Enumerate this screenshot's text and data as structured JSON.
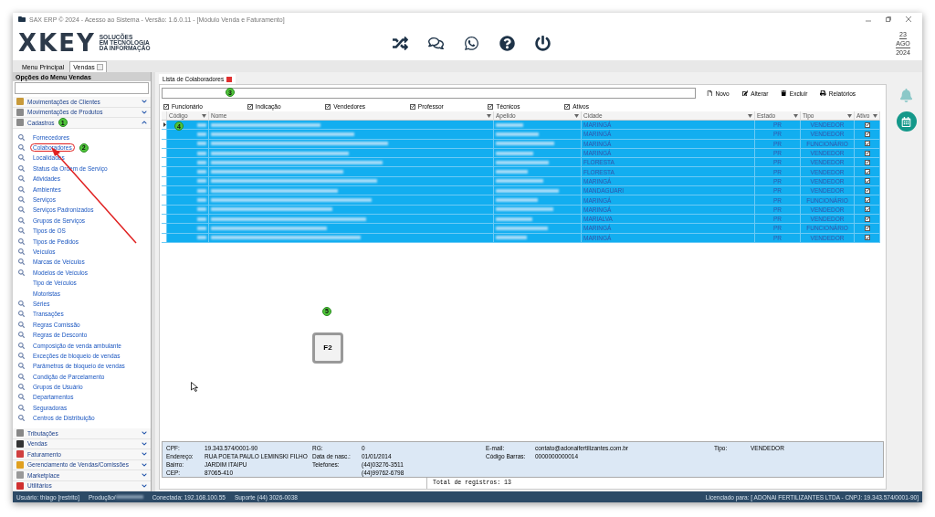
{
  "window": {
    "title": "SAX ERP © 2024 - Acesso ao Sistema - Versão: 1.6.0.11 - [Módulo Venda e Faturamento]"
  },
  "logo": {
    "mark": "XKEY",
    "tagline": [
      "SOLUÇÕES",
      "EM TECNOLOGIA",
      "DA INFORMAÇÃO"
    ]
  },
  "date": {
    "day": "23",
    "month": "AGO",
    "year": "2024"
  },
  "tabs": [
    {
      "label": "Menu Principal",
      "selected": false,
      "closable": false
    },
    {
      "label": "Vendas",
      "selected": true,
      "closable": true
    }
  ],
  "sidebar": {
    "title": "Opções do Menu Vendas",
    "groups": [
      {
        "label": "Movimentações de Clientes",
        "expanded": false
      },
      {
        "label": "Movimentações de Produtos",
        "expanded": false
      },
      {
        "label": "Cadastros",
        "expanded": true,
        "badge": "1",
        "children": [
          {
            "label": "Fornecedores",
            "kind": "search",
            "circled": false
          },
          {
            "label": "Colaboradores",
            "kind": "search",
            "circled": true,
            "badge": "2"
          },
          {
            "label": "Localidades",
            "kind": "search",
            "circled": false
          },
          {
            "label": "Status da Ordem de Serviço",
            "kind": "search",
            "circled": false
          },
          {
            "label": "Atividades",
            "kind": "search",
            "circled": false
          },
          {
            "label": "Ambientes",
            "kind": "search",
            "circled": false
          },
          {
            "label": "Serviços",
            "kind": "search",
            "circled": false
          },
          {
            "label": "Serviços Padronizados",
            "kind": "search",
            "circled": false
          },
          {
            "label": "Grupos de Serviços",
            "kind": "search",
            "circled": false
          },
          {
            "label": "Tipos de OS",
            "kind": "search",
            "circled": false
          },
          {
            "label": "Tipos de Pedidos",
            "kind": "search",
            "circled": false
          },
          {
            "label": "Veículos",
            "kind": "search",
            "circled": false
          },
          {
            "label": "Marcas de Veículos",
            "kind": "search",
            "circled": false
          },
          {
            "label": "Modelos de Veículos",
            "kind": "search",
            "circled": false
          },
          {
            "label": "Tipo de Veículos",
            "kind": "plain",
            "circled": false
          },
          {
            "label": "Motoristas",
            "kind": "plain",
            "circled": false
          },
          {
            "label": "Séries",
            "kind": "search",
            "circled": false
          },
          {
            "label": "Transações",
            "kind": "search",
            "circled": false
          },
          {
            "label": "Regras Comissão",
            "kind": "search",
            "circled": false
          },
          {
            "label": "Regras de Desconto",
            "kind": "search",
            "circled": false
          },
          {
            "label": "Composição de venda ambulante",
            "kind": "search",
            "circled": false
          },
          {
            "label": "Exceções de bloqueio de vendas",
            "kind": "search",
            "circled": false
          },
          {
            "label": "Parâmetros de bloqueio de vendas",
            "kind": "search",
            "circled": false
          },
          {
            "label": "Condição de Parcelamento",
            "kind": "search",
            "circled": false
          },
          {
            "label": "Grupos de Usuário",
            "kind": "search",
            "circled": false
          },
          {
            "label": "Departamentos",
            "kind": "search",
            "circled": false
          },
          {
            "label": "Seguradoras",
            "kind": "search",
            "circled": false
          },
          {
            "label": "Centros de Distribuição",
            "kind": "search",
            "circled": false
          }
        ]
      },
      {
        "label": "Tributações",
        "expanded": false
      },
      {
        "label": "Vendas",
        "expanded": false
      },
      {
        "label": "Faturamento",
        "expanded": false
      },
      {
        "label": "Gerenciamento de Vendas/Comissões",
        "expanded": false
      },
      {
        "label": "Marketplace",
        "expanded": false
      },
      {
        "label": "Utilitários",
        "expanded": false
      }
    ]
  },
  "document_tab": {
    "label": "Lista de Colaboradores"
  },
  "toolbar": {
    "search_badge": "3",
    "buttons": [
      "Novo",
      "Alterar",
      "Excluir",
      "Relatórios"
    ]
  },
  "filters": [
    {
      "label": "Funcionário",
      "checked": true
    },
    {
      "label": "Indicação",
      "checked": true
    },
    {
      "label": "Vendedores",
      "checked": true
    },
    {
      "label": "Professor",
      "checked": true
    },
    {
      "label": "Técnicos",
      "checked": true
    },
    {
      "label": "Ativos",
      "checked": true
    }
  ],
  "table": {
    "columns": [
      "Código",
      "Nome",
      "Apelido",
      "Cidade",
      "Estado",
      "Tipo",
      "Ativo"
    ],
    "row_badge": "4",
    "rows": [
      {
        "cidade": "MARINGÁ",
        "estado": "PR",
        "tipo": "VENDEDOR",
        "ativo": true,
        "selected": true,
        "current": true
      },
      {
        "cidade": "MARINGÁ",
        "estado": "PR",
        "tipo": "VENDEDOR",
        "ativo": true,
        "selected": true,
        "current": false
      },
      {
        "cidade": "MARINGÁ",
        "estado": "PR",
        "tipo": "FUNCIONÁRIO",
        "ativo": true,
        "selected": true,
        "current": false
      },
      {
        "cidade": "MARINGÁ",
        "estado": "PR",
        "tipo": "VENDEDOR",
        "ativo": true,
        "selected": true,
        "current": false
      },
      {
        "cidade": "FLORESTA",
        "estado": "PR",
        "tipo": "VENDEDOR",
        "ativo": true,
        "selected": true,
        "current": false
      },
      {
        "cidade": "FLORESTA",
        "estado": "PR",
        "tipo": "VENDEDOR",
        "ativo": true,
        "selected": true,
        "current": false
      },
      {
        "cidade": "MARINGÁ",
        "estado": "PR",
        "tipo": "VENDEDOR",
        "ativo": true,
        "selected": true,
        "current": false
      },
      {
        "cidade": "MANDAGUARI",
        "estado": "PR",
        "tipo": "VENDEDOR",
        "ativo": true,
        "selected": true,
        "current": false
      },
      {
        "cidade": "MARINGÁ",
        "estado": "PR",
        "tipo": "FUNCIONÁRIO",
        "ativo": true,
        "selected": true,
        "current": false
      },
      {
        "cidade": "MARINGÁ",
        "estado": "PR",
        "tipo": "VENDEDOR",
        "ativo": true,
        "selected": true,
        "current": false
      },
      {
        "cidade": "MARIALVA",
        "estado": "PR",
        "tipo": "VENDEDOR",
        "ativo": true,
        "selected": true,
        "current": false
      },
      {
        "cidade": "MARINGÁ",
        "estado": "PR",
        "tipo": "FUNCIONÁRIO",
        "ativo": true,
        "selected": true,
        "current": false
      },
      {
        "cidade": "MARINGÁ",
        "estado": "PR",
        "tipo": "VENDEDOR",
        "ativo": true,
        "selected": true,
        "current": false
      }
    ]
  },
  "hint": {
    "badge": "5",
    "key": "F2"
  },
  "details": [
    [
      {
        "label": "CPF:",
        "value": "19.343.574/0001-90"
      },
      {
        "label": "Endereço:",
        "value": "RUA POETA PAULO LEMINSKI FILHO"
      },
      {
        "label": "Bairro:",
        "value": "JARDIM ITAIPU"
      },
      {
        "label": "CEP:",
        "value": "87065-410"
      }
    ],
    [
      {
        "label": "RG:",
        "value": "0"
      },
      {
        "label": "Data de nasc.:",
        "value": "01/01/2014"
      },
      {
        "label": "Telefones:",
        "value": "(44)03276-3511"
      },
      {
        "value": "(44)99762-6798"
      }
    ],
    [
      {
        "label": "E-mail:",
        "value": "contato@adonaifertilizantes.com.br"
      },
      {
        "label": "Código Barras:",
        "value": "0000000000014"
      }
    ],
    [
      {
        "label": "Tipo:",
        "value": "VENDEDOR"
      }
    ]
  ],
  "total": "Total de registros: 13",
  "status_bar": {
    "user": "Usuário: thiago [restrito]",
    "environment": "Produção/",
    "connection": "Conectada: 192.168.100.55",
    "support": "Suporte (44) 3026-0038",
    "license": "Licenciado para: [ ADONAI FERTILIZANTES LTDA - CNPJ: 19.343.574/0001-90]"
  }
}
